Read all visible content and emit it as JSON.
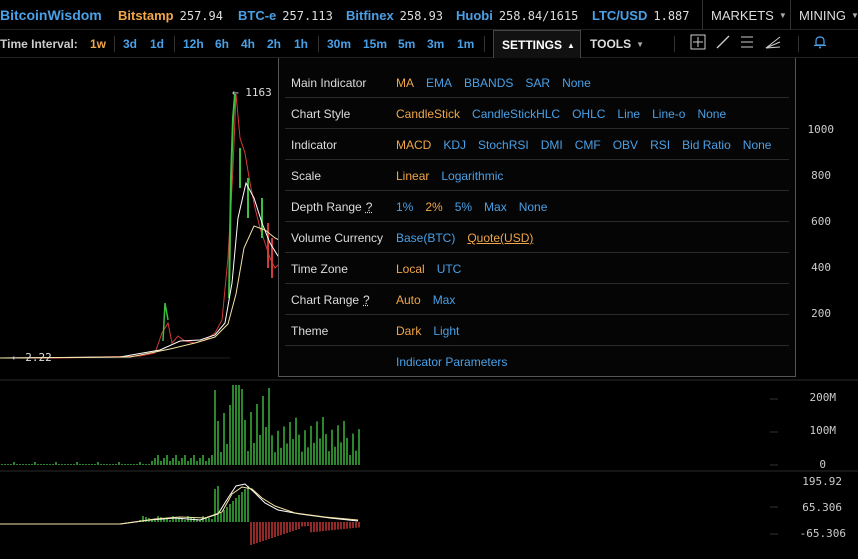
{
  "header": {
    "logo": "BitcoinWisdom",
    "tickers": [
      {
        "name": "Bitstamp",
        "price": "257.94",
        "color": "#f0a64a"
      },
      {
        "name": "BTC-e",
        "price": "257.113",
        "color": "#4aa0e6"
      },
      {
        "name": "Bitfinex",
        "price": "258.93",
        "color": "#4aa0e6"
      },
      {
        "name": "Huobi",
        "price": "258.84/1615",
        "color": "#4aa0e6"
      },
      {
        "name": "LTC/USD",
        "price": "1.887",
        "color": "#4aa0e6"
      }
    ],
    "menus": {
      "markets": "MARKETS",
      "mining": "MINING"
    }
  },
  "interval_bar": {
    "label": "Time Interval:",
    "intervals": [
      "1w",
      "3d",
      "1d",
      "12h",
      "6h",
      "4h",
      "2h",
      "1h",
      "30m",
      "15m",
      "5m",
      "3m",
      "1m"
    ],
    "active": "1w",
    "settings_label": "SETTINGS",
    "tools_label": "TOOLS",
    "icons": [
      "crosshair-icon",
      "line-draw-icon",
      "horizontal-lines-icon",
      "fan-icon",
      "bell-icon"
    ]
  },
  "settings": {
    "rows": [
      {
        "label": "Main Indicator",
        "options": [
          {
            "t": "MA",
            "s": "sel"
          },
          {
            "t": "EMA"
          },
          {
            "t": "BBANDS"
          },
          {
            "t": "SAR"
          },
          {
            "t": "None"
          }
        ]
      },
      {
        "label": "Chart Style",
        "options": [
          {
            "t": "CandleStick",
            "s": "sel"
          },
          {
            "t": "CandleStickHLC"
          },
          {
            "t": "OHLC"
          },
          {
            "t": "Line"
          },
          {
            "t": "Line-o"
          },
          {
            "t": "None"
          }
        ]
      },
      {
        "label": "Indicator",
        "options": [
          {
            "t": "MACD",
            "s": "sel"
          },
          {
            "t": "KDJ"
          },
          {
            "t": "StochRSI"
          },
          {
            "t": "DMI"
          },
          {
            "t": "CMF"
          },
          {
            "t": "OBV"
          },
          {
            "t": "RSI"
          },
          {
            "t": "Bid Ratio"
          },
          {
            "t": "None"
          }
        ]
      },
      {
        "label": "Scale",
        "options": [
          {
            "t": "Linear",
            "s": "sel"
          },
          {
            "t": "Logarithmic"
          }
        ]
      },
      {
        "label": "Depth Range",
        "help": "?",
        "options": [
          {
            "t": "1%"
          },
          {
            "t": "2%",
            "s": "sel"
          },
          {
            "t": "5%"
          },
          {
            "t": "Max"
          },
          {
            "t": "None"
          }
        ]
      },
      {
        "label": "Volume Currency",
        "options": [
          {
            "t": "Base(BTC)"
          },
          {
            "t": "Quote(USD)",
            "s": "sel-u"
          }
        ]
      },
      {
        "label": "Time Zone",
        "options": [
          {
            "t": "Local",
            "s": "sel"
          },
          {
            "t": "UTC"
          }
        ]
      },
      {
        "label": "Chart Range",
        "help": "?",
        "options": [
          {
            "t": "Auto",
            "s": "sel"
          },
          {
            "t": "Max"
          }
        ]
      },
      {
        "label": "Theme",
        "options": [
          {
            "t": "Dark",
            "s": "sel"
          },
          {
            "t": "Light"
          }
        ]
      },
      {
        "label": "",
        "options": [
          {
            "t": "Indicator Parameters"
          }
        ]
      }
    ]
  },
  "chart": {
    "price_axis": [
      "1000",
      "800",
      "600",
      "400",
      "200"
    ],
    "volume_axis": [
      "200M",
      "100M",
      "0"
    ],
    "macd_axis": [
      "195.92",
      "65.306",
      "-65.306"
    ],
    "high_annotation": "← 1163",
    "low_annotation": "← 2.22"
  },
  "colors": {
    "accent": "#4aa0e6",
    "selected": "#f0a64a",
    "up": "#3fbf3f",
    "down": "#d23a3a"
  }
}
